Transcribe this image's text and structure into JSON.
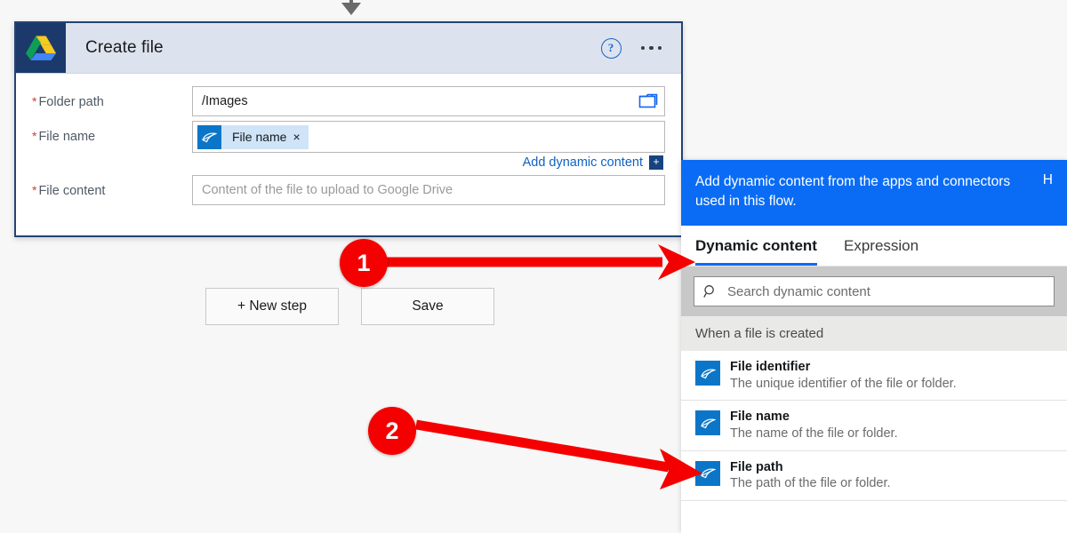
{
  "card": {
    "title": "Create file",
    "app_icon": "google-drive-icon",
    "help_icon": "help-circle-icon",
    "more_icon": "ellipsis-icon",
    "fields": [
      {
        "label": "Folder path",
        "required_marker": "*",
        "value": "/Images",
        "placeholder": "",
        "trailing_icon": "folder-picker-icon"
      },
      {
        "label": "File name",
        "required_marker": "*",
        "token": {
          "label": "File name",
          "remove": "×",
          "icon": "dynamic-content-token-icon"
        }
      },
      {
        "label": "File content",
        "required_marker": "*",
        "value": "",
        "placeholder": "Content of the file to upload to Google Drive"
      }
    ],
    "add_dynamic_content": {
      "label": "Add dynamic content",
      "plus": "+"
    }
  },
  "buttons": {
    "new_step": "+ New step",
    "save": "Save"
  },
  "panel": {
    "callout": {
      "text": "Add dynamic content from the apps and connectors used in this flow.",
      "hide": "H"
    },
    "tabs": [
      {
        "label": "Dynamic content",
        "active": true
      },
      {
        "label": "Expression",
        "active": false
      }
    ],
    "search": {
      "placeholder": "Search dynamic content",
      "icon": "search-icon"
    },
    "group_header": "When a file is created",
    "items": [
      {
        "name": "File identifier",
        "desc": "The unique identifier of the file or folder.",
        "icon": "dynamic-content-token-icon"
      },
      {
        "name": "File name",
        "desc": "The name of the file or folder.",
        "icon": "dynamic-content-token-icon"
      },
      {
        "name": "File path",
        "desc": "The path of the file or folder.",
        "icon": "dynamic-content-token-icon"
      }
    ]
  },
  "annotations": {
    "badge1": "1",
    "badge2": "2",
    "arrow_color": "#f50000"
  }
}
